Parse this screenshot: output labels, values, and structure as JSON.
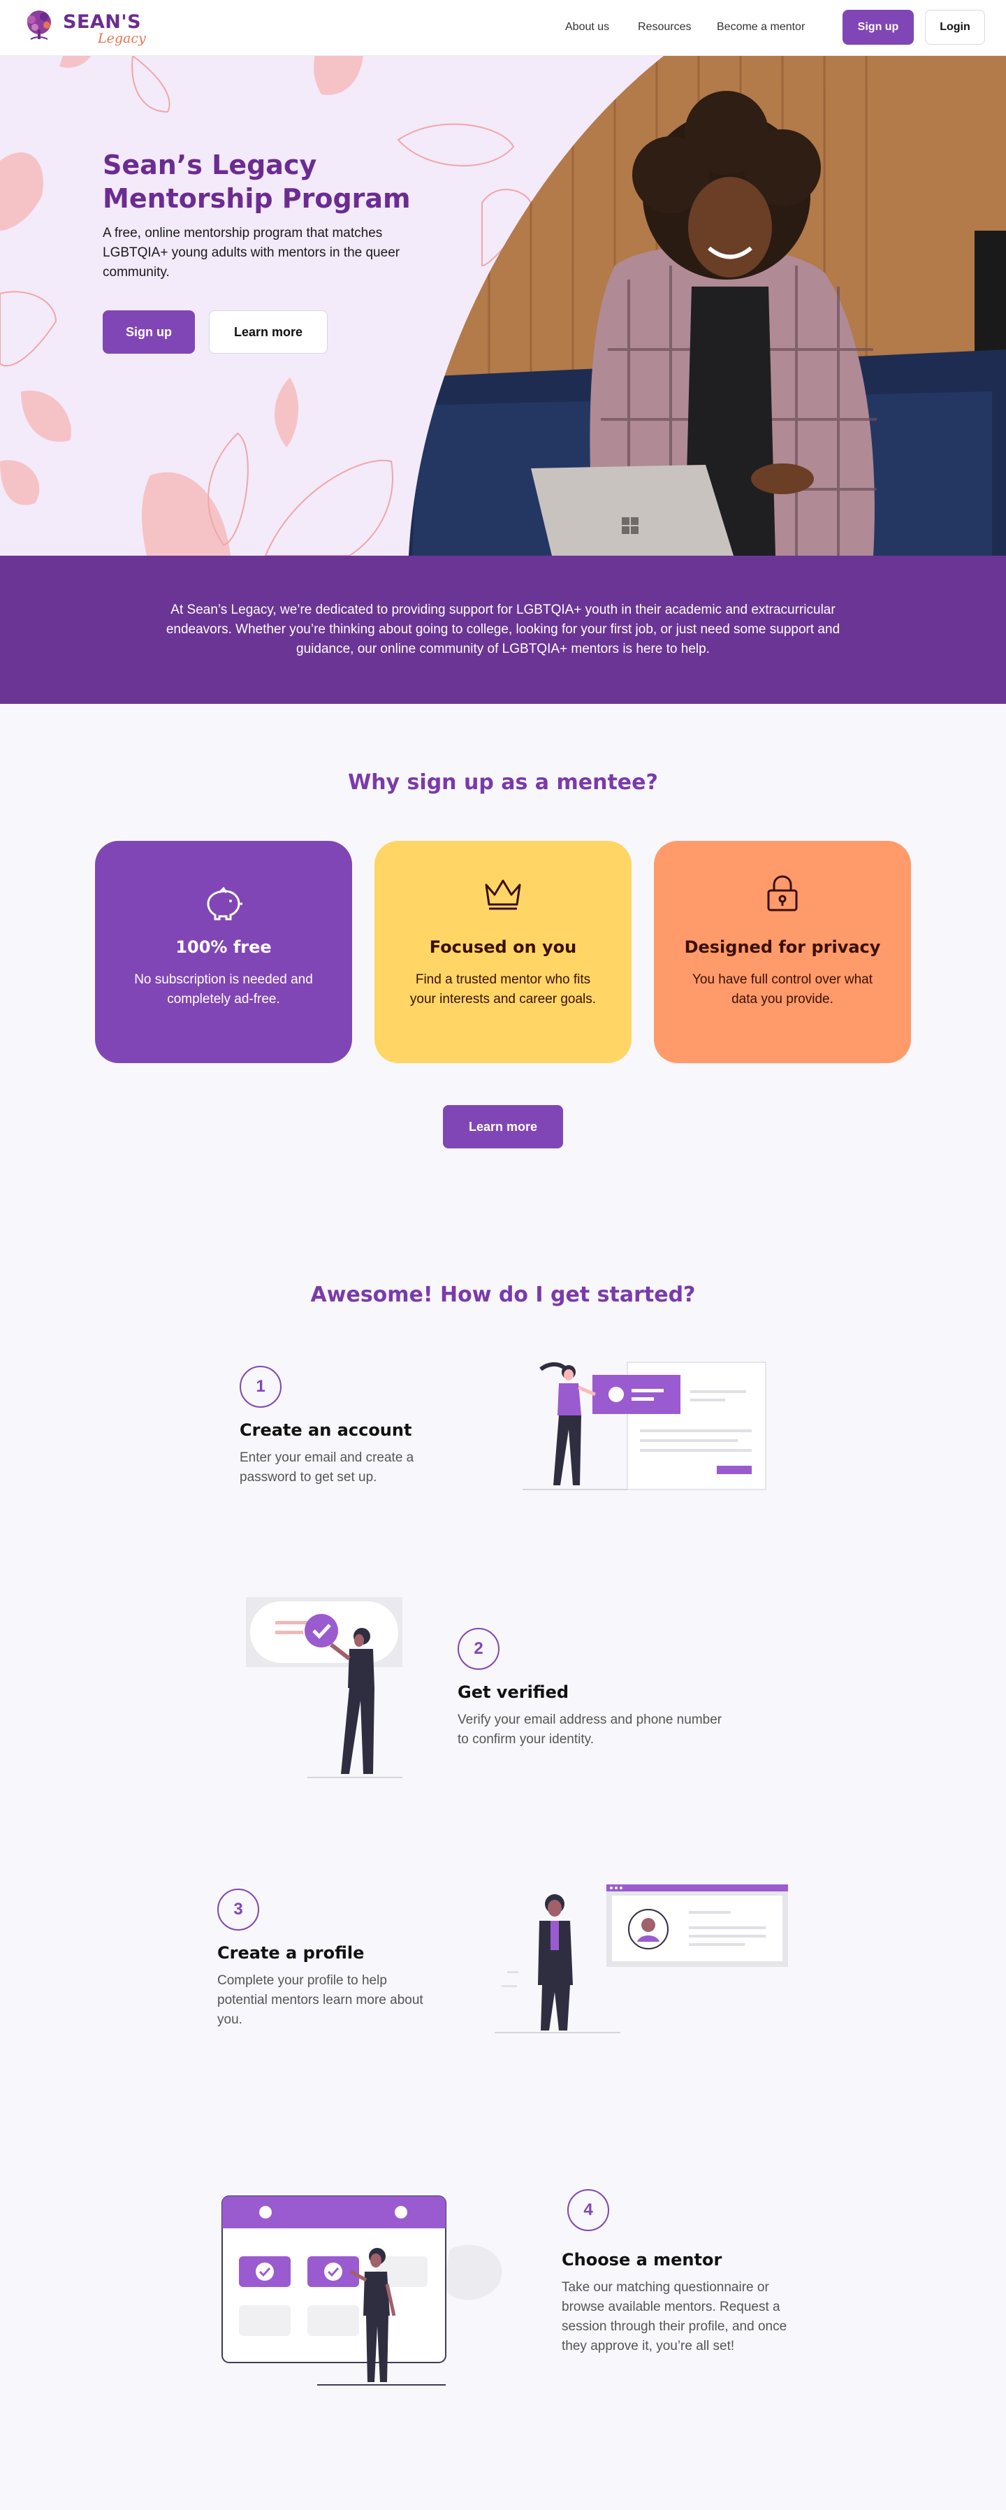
{
  "nav": {
    "logo_word": "SEAN'S",
    "logo_script": "Legacy",
    "links": [
      "About us",
      "Resources",
      "Become a mentor"
    ],
    "signup_label": "Sign up",
    "login_label": "Login"
  },
  "hero": {
    "title": "Sean’s Legacy Mentorship Program",
    "description": "A free, online mentorship program that matches LGBTQIA+ young adults with mentors in the queer community.",
    "signup_label": "Sign up",
    "learn_more_label": "Learn more"
  },
  "banner": {
    "text": "At Sean’s Legacy, we’re dedicated to providing support for LGBTQIA+ youth in their academic and extracurricular endeavors. Whether you’re thinking about going to college, looking for your first job, or just need some support and guidance, our online community of LGBTQIA+ mentors is here to help."
  },
  "why": {
    "title": "Why sign up as a mentee?",
    "cards": [
      {
        "icon": "piggy-bank-icon",
        "title": "100% free",
        "description": "No subscription is needed and completely ad-free.",
        "bg": "#8146b5",
        "fg": "#ffffff"
      },
      {
        "icon": "crown-icon",
        "title": "Focused on you",
        "description": "Find a trusted mentor who fits your interests and career goals.",
        "bg": "#ffd666",
        "fg": "#3a1005"
      },
      {
        "icon": "lock-icon",
        "title": "Designed for privacy",
        "description": "You have full control over what data you provide.",
        "bg": "#ff9a6a",
        "fg": "#3a1005"
      }
    ],
    "learn_more_label": "Learn more"
  },
  "start": {
    "title": "Awesome! How do I get started?",
    "steps": [
      {
        "number": "1",
        "title": "Create an account",
        "description": "Enter your email and create a password to get set up."
      },
      {
        "number": "2",
        "title": "Get verified",
        "description": "Verify your email address and phone number to confirm your identity."
      },
      {
        "number": "3",
        "title": "Create a profile",
        "description": "Complete your profile to help potential mentors learn more about you."
      },
      {
        "number": "4",
        "title": "Choose a mentor",
        "description": "Take our matching questionnaire or browse available mentors. Request a session through their profile, and once they approve it, you’re all set!"
      }
    ]
  },
  "colors": {
    "brand_purple": "#8146b5",
    "title_purple": "#6b2c91",
    "banner_purple": "#6b3595",
    "hero_bg": "#f3eafa",
    "petal_pink": "#f5c3c6",
    "accent_orange": "#e8744f"
  }
}
